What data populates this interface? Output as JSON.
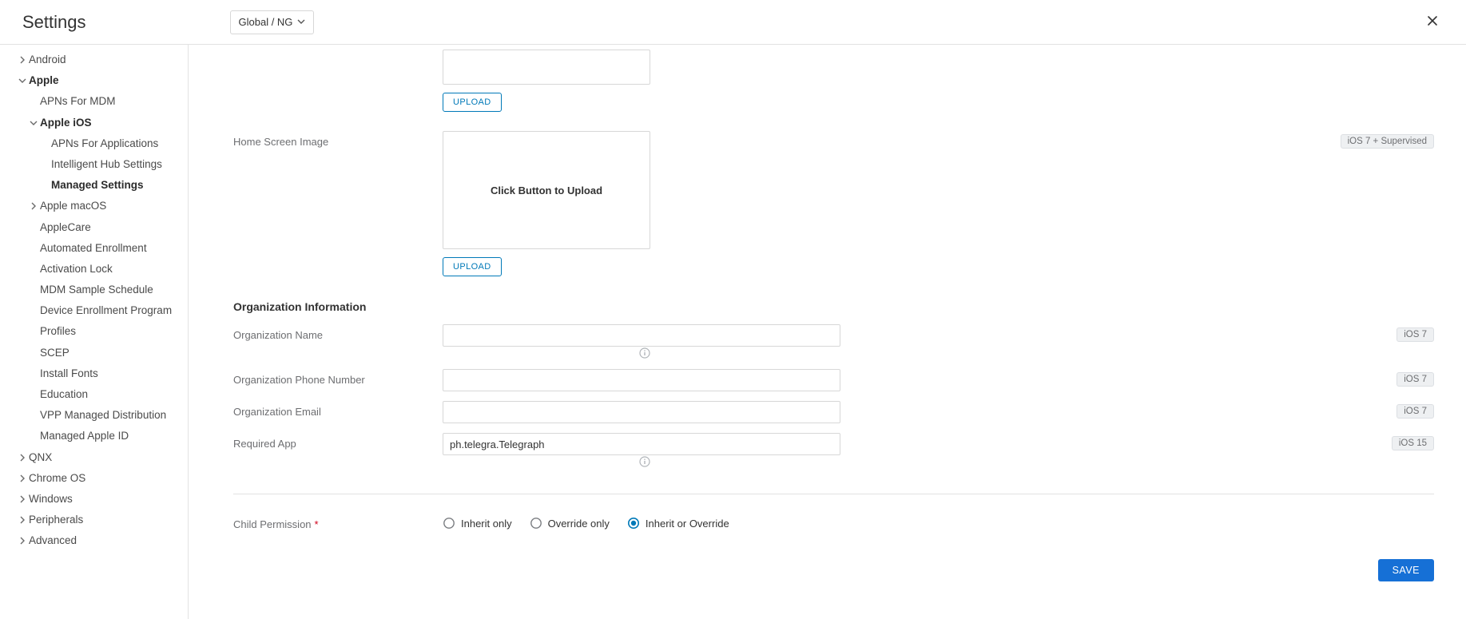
{
  "header": {
    "title": "Settings",
    "scope": "Global / NG"
  },
  "sidebar": {
    "items": [
      {
        "label": "Android",
        "level": 1,
        "expander": "closed"
      },
      {
        "label": "Apple",
        "level": 1,
        "expander": "open",
        "bold": true
      },
      {
        "label": "APNs For MDM",
        "level": 2
      },
      {
        "label": "Apple iOS",
        "level": 2,
        "expander": "open",
        "bold": true
      },
      {
        "label": "APNs For Applications",
        "level": 3
      },
      {
        "label": "Intelligent Hub Settings",
        "level": 3
      },
      {
        "label": "Managed Settings",
        "level": 3,
        "bold": true
      },
      {
        "label": "Apple macOS",
        "level": 2,
        "expander": "closed"
      },
      {
        "label": "AppleCare",
        "level": 2
      },
      {
        "label": "Automated Enrollment",
        "level": 2
      },
      {
        "label": "Activation Lock",
        "level": 2
      },
      {
        "label": "MDM Sample Schedule",
        "level": 2
      },
      {
        "label": "Device Enrollment Program",
        "level": 2
      },
      {
        "label": "Profiles",
        "level": 2
      },
      {
        "label": "SCEP",
        "level": 2
      },
      {
        "label": "Install Fonts",
        "level": 2
      },
      {
        "label": "Education",
        "level": 2
      },
      {
        "label": "VPP Managed Distribution",
        "level": 2
      },
      {
        "label": "Managed Apple ID",
        "level": 2
      },
      {
        "label": "QNX",
        "level": 1,
        "expander": "closed"
      },
      {
        "label": "Chrome OS",
        "level": 1,
        "expander": "closed"
      },
      {
        "label": "Windows",
        "level": 1,
        "expander": "closed"
      },
      {
        "label": "Peripherals",
        "level": 1,
        "expander": "closed"
      },
      {
        "label": "Advanced",
        "level": 1,
        "expander": "closed"
      }
    ]
  },
  "content": {
    "upload_button": "UPLOAD",
    "dropzone_text": "Click Button to Upload",
    "home_screen_label": "Home Screen Image",
    "badge_ios7_supervised": "iOS 7 + Supervised",
    "section_org_info": "Organization Information",
    "org_name_label": "Organization Name",
    "org_name_value": "",
    "org_phone_label": "Organization Phone Number",
    "org_phone_value": "",
    "org_email_label": "Organization Email",
    "org_email_value": "",
    "required_app_label": "Required App",
    "required_app_value": "ph.telegra.Telegraph",
    "badge_ios7": "iOS 7",
    "badge_ios15": "iOS 15",
    "child_perm_label": "Child Permission",
    "radio_inherit_only": "Inherit only",
    "radio_override_only": "Override only",
    "radio_inherit_or_override": "Inherit or Override",
    "child_perm_selected": "inherit_or_override",
    "save": "SAVE"
  }
}
